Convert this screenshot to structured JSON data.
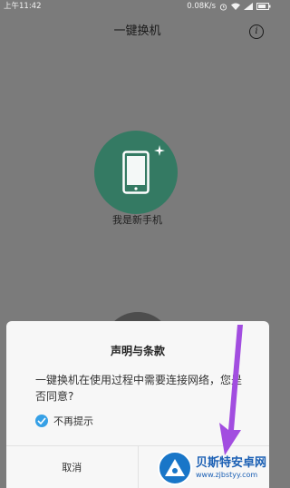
{
  "status_bar": {
    "time": "上午11:42",
    "network_speed": "0.08K/s"
  },
  "header": {
    "title": "一键换机",
    "info_icon": "info-icon"
  },
  "main": {
    "new_phone_label": "我是新手机",
    "phone_icon": "phone-icon",
    "sparkle_icon": "sparkle-icon"
  },
  "dialog": {
    "title": "声明与条款",
    "message": "一键换机在使用过程中需要连接网络，您是否同意?",
    "checkbox_label": "不再提示",
    "checkbox_checked": true,
    "cancel_label": "取消",
    "confirm_label": ""
  },
  "watermark": {
    "name": "贝斯特安卓网",
    "url": "www.zjbstyy.com"
  },
  "colors": {
    "dim_background": "#7b7b7b",
    "phone_circle": "#347a63",
    "checkbox_accent": "#36a0e6",
    "arrow": "#a24de0"
  }
}
